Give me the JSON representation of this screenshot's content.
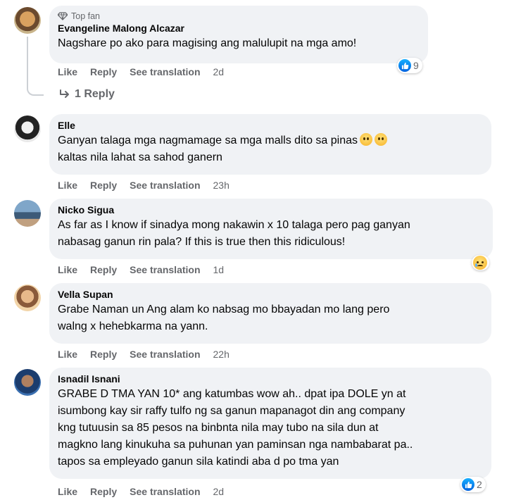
{
  "comments": [
    {
      "author": "Evangeline Malong Alcazar",
      "badge": "Top fan",
      "text": "Nagshare po ako para magising ang malulupit na mga amo!",
      "like_label": "Like",
      "reply_label": "Reply",
      "translate_label": "See translation",
      "time": "2d",
      "reaction_count": "9",
      "reaction_icon": "like-icon",
      "replies_label": "1 Reply"
    },
    {
      "author": "Elle",
      "text_line1": "Ganyan talaga mga nagmamage sa mga malls dito sa pinas",
      "text_line2": "kaltas nila lahat sa sahod ganern",
      "like_label": "Like",
      "reply_label": "Reply",
      "translate_label": "See translation",
      "time": "23h"
    },
    {
      "author": "Nicko Sigua",
      "text_line1": "As far as I know if sinadya mong nakawin x 10 talaga pero pag ganyan",
      "text_line2": "nabasag ganun rin pala? If this is true then this ridiculous!",
      "like_label": "Like",
      "reply_label": "Reply",
      "translate_label": "See translation",
      "time": "1d",
      "reaction_icon": "sad-icon"
    },
    {
      "author": "Vella Supan",
      "text_line1": "Grabe Naman un Ang alam ko nabsag mo bbayadan mo lang pero",
      "text_line2": "walng x hehebkarma na yann.",
      "like_label": "Like",
      "reply_label": "Reply",
      "translate_label": "See translation",
      "time": "22h"
    },
    {
      "author": "Isnadil Isnani",
      "text_line1": "GRABE D TMA YAN 10* ang katumbas wow ah.. dpat ipa DOLE yn at",
      "text_line2": "isumbong kay sir raffy tulfo ng sa ganun mapanagot din ang company",
      "text_line3": "kng tutuusin sa 85 pesos na binbnta nila may tubo na sila dun at",
      "text_line4": "magkno lang kinukuha sa puhunan yan paminsan nga nambabarat pa..",
      "text_line5": "tapos sa empleyado ganun sila katindi aba d po tma yan",
      "like_label": "Like",
      "reply_label": "Reply",
      "translate_label": "See translation",
      "time": "2d",
      "reaction_count": "2",
      "reaction_icon": "like-icon"
    }
  ],
  "colors": {
    "bubble": "#f0f2f5",
    "meta": "#65676b",
    "like_blue": "#0866ff"
  }
}
